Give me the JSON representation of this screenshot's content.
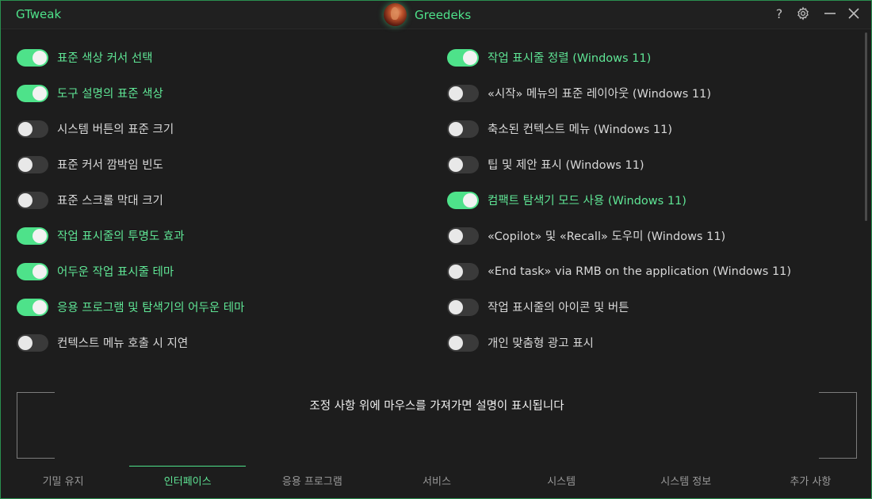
{
  "app": {
    "title": "GTweak",
    "username": "Greedeks"
  },
  "titlebar": {
    "help_icon": "?",
    "settings_icon": "gear-icon",
    "minimize_icon": "minimize-icon",
    "close_icon": "close-icon"
  },
  "colors": {
    "accent": "#4ee28a",
    "toggle_off": "#3a3a3a",
    "background": "#1d1d1d"
  },
  "left_toggles": [
    {
      "label": "표준 색상 커서 선택",
      "on": true
    },
    {
      "label": "도구 설명의 표준 색상",
      "on": true
    },
    {
      "label": "시스템 버튼의 표준 크기",
      "on": false
    },
    {
      "label": "표준 커서 깜박임 빈도",
      "on": false
    },
    {
      "label": "표준 스크롤 막대 크기",
      "on": false
    },
    {
      "label": "작업 표시줄의 투명도 효과",
      "on": true
    },
    {
      "label": "어두운 작업 표시줄 테마",
      "on": true
    },
    {
      "label": "응용 프로그램 및 탐색기의 어두운 테마",
      "on": true
    },
    {
      "label": "컨텍스트 메뉴 호출 시 지연",
      "on": false
    }
  ],
  "right_toggles": [
    {
      "label": "작업 표시줄 정렬 (Windows 11)",
      "on": true
    },
    {
      "label": "«시작» 메뉴의 표준 레이아웃 (Windows 11)",
      "on": false
    },
    {
      "label": "축소된 컨텍스트 메뉴 (Windows 11)",
      "on": false
    },
    {
      "label": "팁 및 제안 표시 (Windows 11)",
      "on": false
    },
    {
      "label": "컴팩트 탐색기 모드 사용 (Windows 11)",
      "on": true
    },
    {
      "label": "«Copilot» 및 «Recall» 도우미 (Windows 11)",
      "on": false
    },
    {
      "label": "«End task» via RMB on the application (Windows 11)",
      "on": false
    },
    {
      "label": "작업 표시줄의 아이콘 및 버튼",
      "on": false
    },
    {
      "label": "개인 맞춤형 광고 표시",
      "on": false
    }
  ],
  "description": {
    "text": "조정 사항 위에 마우스를 가져가면 설명이 표시됩니다"
  },
  "tabs": [
    {
      "label": "기밀 유지",
      "active": false
    },
    {
      "label": "인터페이스",
      "active": true
    },
    {
      "label": "응용 프로그램",
      "active": false
    },
    {
      "label": "서비스",
      "active": false
    },
    {
      "label": "시스템",
      "active": false
    },
    {
      "label": "시스템 정보",
      "active": false
    },
    {
      "label": "추가 사항",
      "active": false
    }
  ]
}
